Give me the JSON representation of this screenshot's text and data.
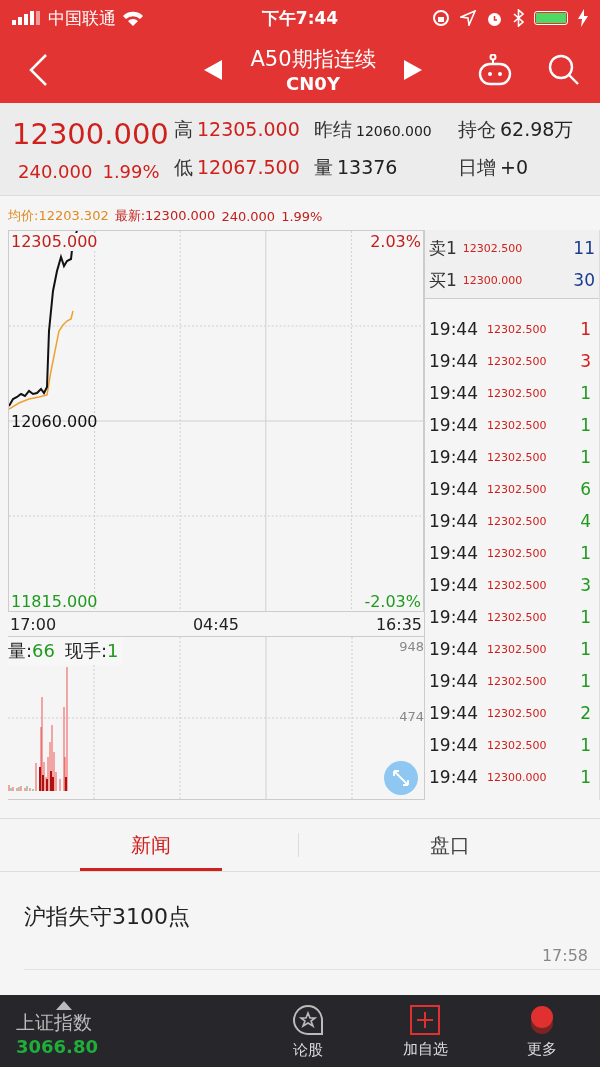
{
  "status_bar": {
    "carrier": "中国联通",
    "time": "下午7:44"
  },
  "nav": {
    "title": "A50期指连续",
    "code": "CN0Y"
  },
  "quote": {
    "price": "12300.000",
    "change": "240.000",
    "change_pct": "1.99%",
    "stats": [
      {
        "label": "高",
        "value": "12305.000",
        "color": "#d0201c"
      },
      {
        "label": "昨结",
        "value": "12060.000",
        "color": "#222222",
        "small": true
      },
      {
        "label": "持仓",
        "value": "62.98万",
        "color": "#222222"
      },
      {
        "label": "低",
        "value": "12067.500",
        "color": "#d0201c"
      },
      {
        "label": "量",
        "value": "13376",
        "color": "#222222"
      },
      {
        "label": "日增",
        "value": "+0",
        "color": "#222222"
      }
    ]
  },
  "summary": {
    "avg_label": "均价:12203.302",
    "latest_label": "最新:12300.000",
    "change": "240.000",
    "change_pct": "1.99%"
  },
  "chart": {
    "high": "12305.000",
    "mid": "12060.000",
    "low": "11815.000",
    "high_pct": "2.03%",
    "low_pct": "-2.03%",
    "times": [
      "17:00",
      "04:45",
      "16:35"
    ]
  },
  "volume": {
    "label": "量:",
    "value": "66",
    "hand_label": "现手:",
    "hand_value": "1",
    "max": "948",
    "half": "474"
  },
  "order_book": [
    {
      "label": "卖1",
      "price": "12302.500",
      "qty": "11"
    },
    {
      "label": "买1",
      "price": "12300.000",
      "qty": "30"
    }
  ],
  "trades": [
    {
      "time": "19:44",
      "price": "12302.500",
      "qty": "1",
      "color": "#d0201c"
    },
    {
      "time": "19:44",
      "price": "12302.500",
      "qty": "3",
      "color": "#d0201c"
    },
    {
      "time": "19:44",
      "price": "12302.500",
      "qty": "1",
      "color": "#1f9a1f"
    },
    {
      "time": "19:44",
      "price": "12302.500",
      "qty": "1",
      "color": "#1f9a1f"
    },
    {
      "time": "19:44",
      "price": "12302.500",
      "qty": "1",
      "color": "#1f9a1f"
    },
    {
      "time": "19:44",
      "price": "12302.500",
      "qty": "6",
      "color": "#1f9a1f"
    },
    {
      "time": "19:44",
      "price": "12302.500",
      "qty": "4",
      "color": "#1f9a1f"
    },
    {
      "time": "19:44",
      "price": "12302.500",
      "qty": "1",
      "color": "#1f9a1f"
    },
    {
      "time": "19:44",
      "price": "12302.500",
      "qty": "3",
      "color": "#1f9a1f"
    },
    {
      "time": "19:44",
      "price": "12302.500",
      "qty": "1",
      "color": "#1f9a1f"
    },
    {
      "time": "19:44",
      "price": "12302.500",
      "qty": "1",
      "color": "#1f9a1f"
    },
    {
      "time": "19:44",
      "price": "12302.500",
      "qty": "1",
      "color": "#1f9a1f"
    },
    {
      "time": "19:44",
      "price": "12302.500",
      "qty": "2",
      "color": "#1f9a1f"
    },
    {
      "time": "19:44",
      "price": "12302.500",
      "qty": "1",
      "color": "#1f9a1f"
    },
    {
      "time": "19:44",
      "price": "12300.000",
      "qty": "1",
      "color": "#1f9a1f"
    }
  ],
  "tabs": [
    {
      "label": "新闻",
      "selected": true
    },
    {
      "label": "盘口",
      "selected": false
    }
  ],
  "news": [
    {
      "title": "沪指失守3100点",
      "time": "17:58"
    }
  ],
  "bottom_bar": {
    "index_name": "上证指数",
    "index_value": "3066.80",
    "items": [
      {
        "kind": "discuss",
        "label": "论股"
      },
      {
        "kind": "add",
        "label": "加自选"
      },
      {
        "kind": "more",
        "label": "更多"
      }
    ]
  }
}
